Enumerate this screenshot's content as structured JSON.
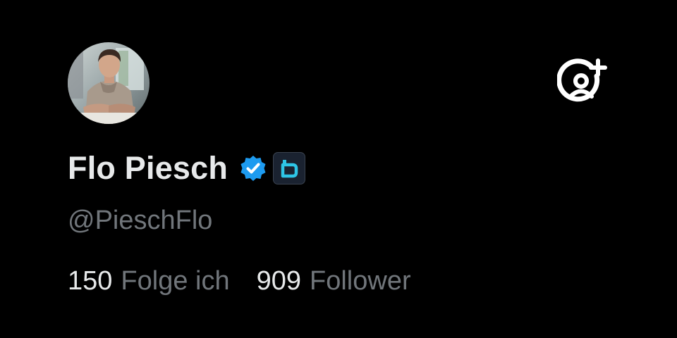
{
  "profile": {
    "display_name": "Flo Piesch",
    "handle": "@PieschFlo",
    "avatar": "profile-photo",
    "verified_badge": "verified-check-icon",
    "affiliate_badge": "affiliate-b-icon"
  },
  "stats": {
    "following_count": "150",
    "following_label": "Folge ich",
    "followers_count": "909",
    "followers_label": "Follower"
  },
  "actions": {
    "follow_icon": "person-add-icon"
  },
  "colors": {
    "background": "#000000",
    "primary_text": "#e7e9ea",
    "secondary_text": "#71767b",
    "verified_blue": "#1d9bf0",
    "affiliate_cyan": "#2ec5e6"
  }
}
